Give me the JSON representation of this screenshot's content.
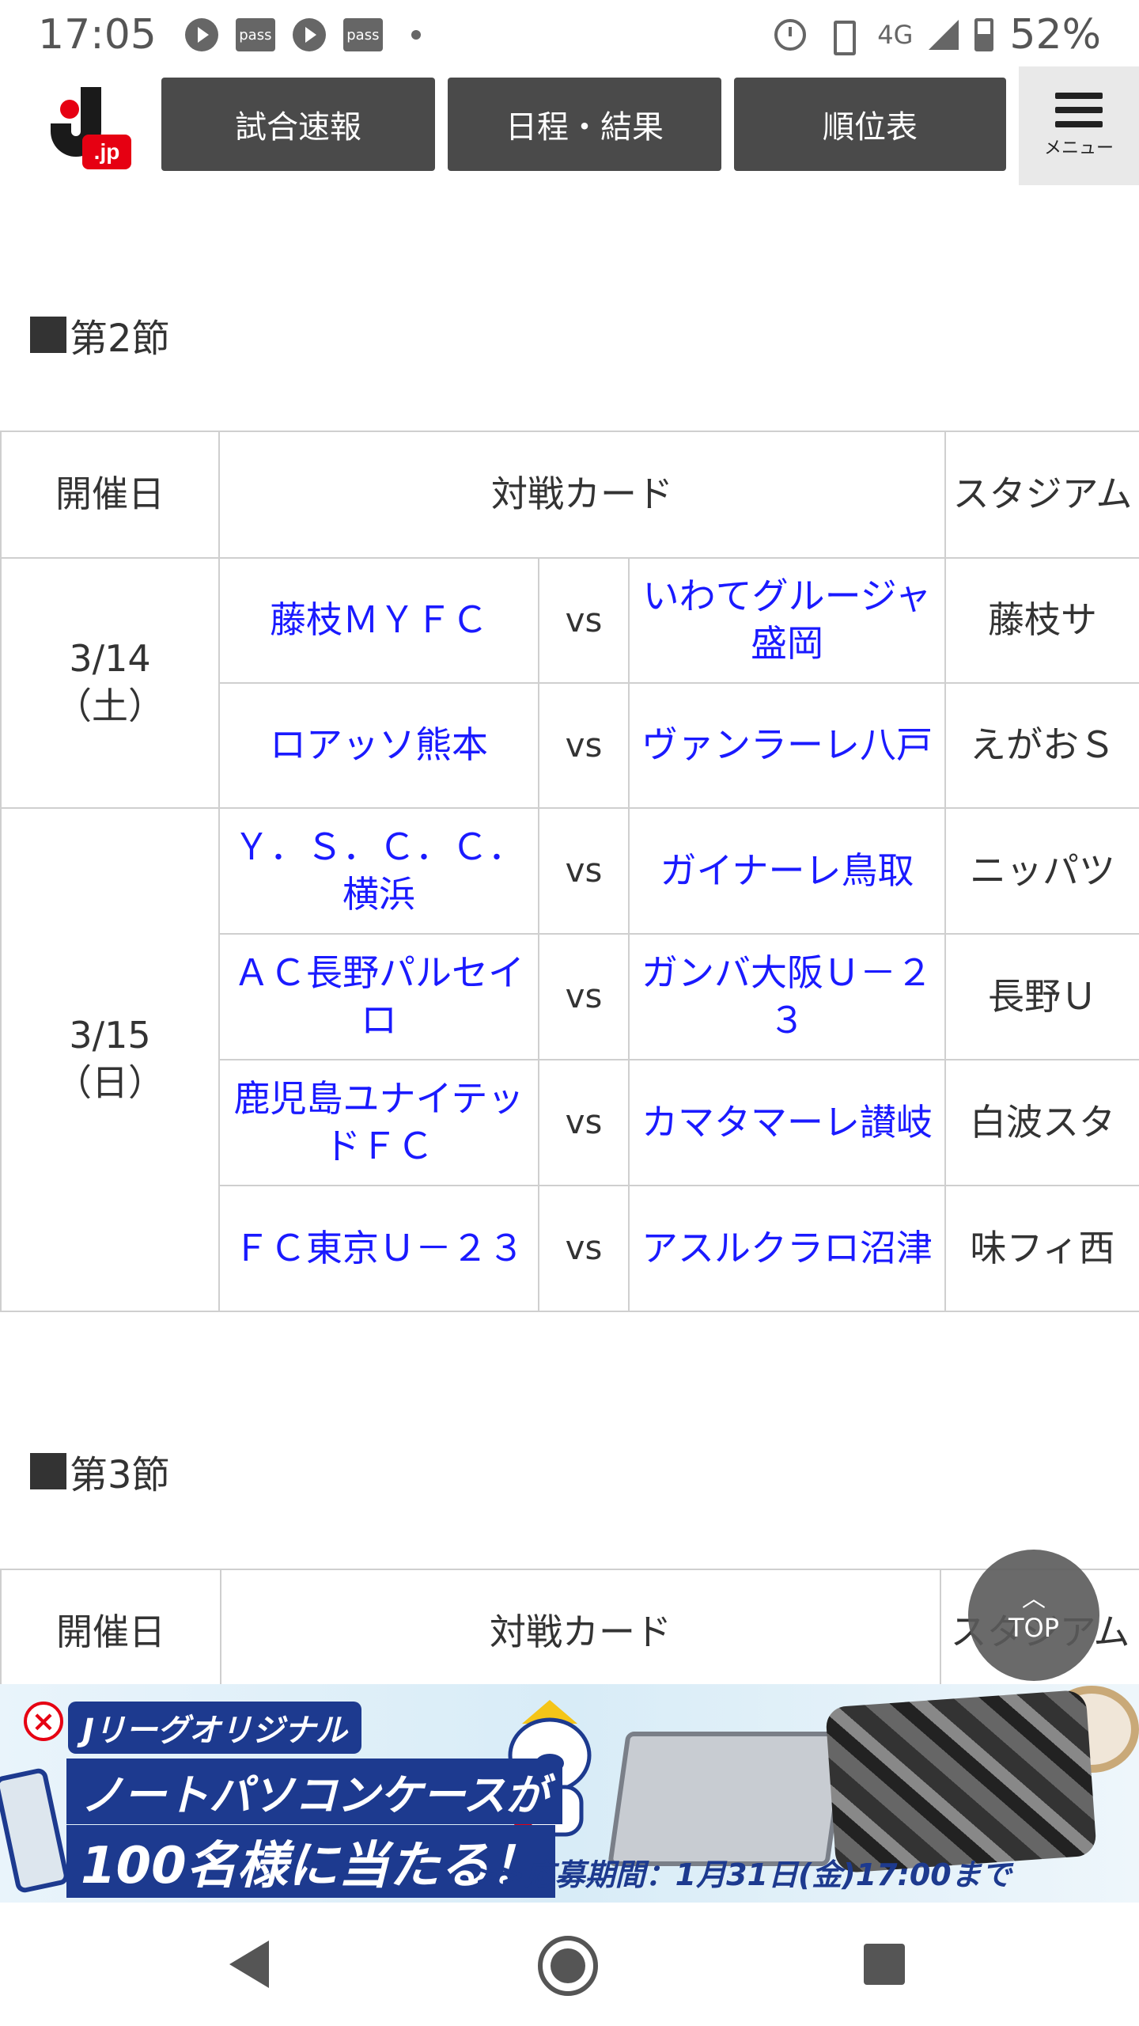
{
  "status_bar": {
    "time": "17:05",
    "pass_label": "pass",
    "network": "4G",
    "battery": "52%"
  },
  "header": {
    "logo_text": "jp",
    "nav": [
      "試合速報",
      "日程・結果",
      "順位表"
    ],
    "menu_label": "メニュー"
  },
  "sections": [
    {
      "title": "第2節",
      "headers": [
        "開催日",
        "対戦カード",
        "スタジアム"
      ],
      "days": [
        {
          "date": "3/14\n（土）",
          "matches": [
            {
              "home": "藤枝ＭＹＦＣ",
              "vs": "vs",
              "away": "いわてグルージャ盛岡",
              "stadium": "藤枝サ"
            },
            {
              "home": "ロアッソ熊本",
              "vs": "vs",
              "away": "ヴァンラーレ八戸",
              "stadium": "えがおＳ"
            }
          ]
        },
        {
          "date": "3/15\n（日）",
          "matches": [
            {
              "home": "Ｙ．Ｓ．Ｃ．Ｃ．横浜",
              "vs": "vs",
              "away": "ガイナーレ鳥取",
              "stadium": "ニッパツ"
            },
            {
              "home": "ＡＣ長野パルセイロ",
              "vs": "vs",
              "away": "ガンバ大阪Ｕ－２３",
              "stadium": "長野Ｕ"
            },
            {
              "home": "鹿児島ユナイテッドＦＣ",
              "vs": "vs",
              "away": "カマタマーレ讃岐",
              "stadium": "白波スタ"
            },
            {
              "home": "ＦＣ東京Ｕ－２３",
              "vs": "vs",
              "away": "アスルクラロ沼津",
              "stadium": "味フィ西"
            }
          ]
        }
      ]
    },
    {
      "title": "第3節",
      "headers": [
        "開催日",
        "対戦カード",
        "スタジアム"
      ]
    }
  ],
  "top_button": {
    "label": "TOP"
  },
  "ad": {
    "close": "×",
    "line1": "Jリーグオリジナル",
    "line2": "ノートパソコンケースが",
    "line3": "100名様に当たる！",
    "line4": ">>応募期間：1月31日(金)17:00まで"
  },
  "colors": {
    "link": "#1a1aff",
    "nav_button": "#4a4a4a",
    "brand_red": "#e60012",
    "border": "#cfcfcf"
  }
}
